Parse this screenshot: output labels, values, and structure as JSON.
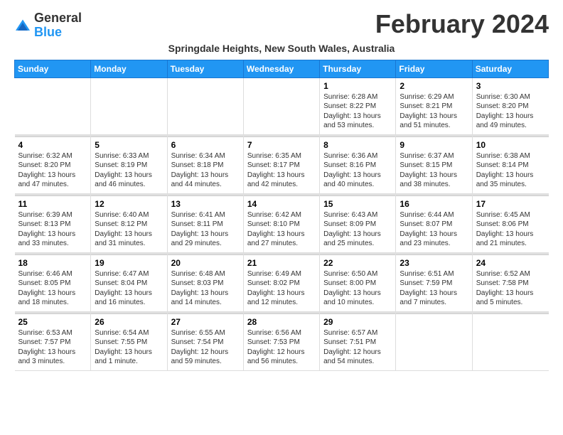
{
  "logo": {
    "general": "General",
    "blue": "Blue"
  },
  "title": "February 2024",
  "subtitle": "Springdale Heights, New South Wales, Australia",
  "days_of_week": [
    "Sunday",
    "Monday",
    "Tuesday",
    "Wednesday",
    "Thursday",
    "Friday",
    "Saturday"
  ],
  "weeks": [
    [
      {
        "num": "",
        "info": ""
      },
      {
        "num": "",
        "info": ""
      },
      {
        "num": "",
        "info": ""
      },
      {
        "num": "",
        "info": ""
      },
      {
        "num": "1",
        "info": "Sunrise: 6:28 AM\nSunset: 8:22 PM\nDaylight: 13 hours\nand 53 minutes."
      },
      {
        "num": "2",
        "info": "Sunrise: 6:29 AM\nSunset: 8:21 PM\nDaylight: 13 hours\nand 51 minutes."
      },
      {
        "num": "3",
        "info": "Sunrise: 6:30 AM\nSunset: 8:20 PM\nDaylight: 13 hours\nand 49 minutes."
      }
    ],
    [
      {
        "num": "4",
        "info": "Sunrise: 6:32 AM\nSunset: 8:20 PM\nDaylight: 13 hours\nand 47 minutes."
      },
      {
        "num": "5",
        "info": "Sunrise: 6:33 AM\nSunset: 8:19 PM\nDaylight: 13 hours\nand 46 minutes."
      },
      {
        "num": "6",
        "info": "Sunrise: 6:34 AM\nSunset: 8:18 PM\nDaylight: 13 hours\nand 44 minutes."
      },
      {
        "num": "7",
        "info": "Sunrise: 6:35 AM\nSunset: 8:17 PM\nDaylight: 13 hours\nand 42 minutes."
      },
      {
        "num": "8",
        "info": "Sunrise: 6:36 AM\nSunset: 8:16 PM\nDaylight: 13 hours\nand 40 minutes."
      },
      {
        "num": "9",
        "info": "Sunrise: 6:37 AM\nSunset: 8:15 PM\nDaylight: 13 hours\nand 38 minutes."
      },
      {
        "num": "10",
        "info": "Sunrise: 6:38 AM\nSunset: 8:14 PM\nDaylight: 13 hours\nand 35 minutes."
      }
    ],
    [
      {
        "num": "11",
        "info": "Sunrise: 6:39 AM\nSunset: 8:13 PM\nDaylight: 13 hours\nand 33 minutes."
      },
      {
        "num": "12",
        "info": "Sunrise: 6:40 AM\nSunset: 8:12 PM\nDaylight: 13 hours\nand 31 minutes."
      },
      {
        "num": "13",
        "info": "Sunrise: 6:41 AM\nSunset: 8:11 PM\nDaylight: 13 hours\nand 29 minutes."
      },
      {
        "num": "14",
        "info": "Sunrise: 6:42 AM\nSunset: 8:10 PM\nDaylight: 13 hours\nand 27 minutes."
      },
      {
        "num": "15",
        "info": "Sunrise: 6:43 AM\nSunset: 8:09 PM\nDaylight: 13 hours\nand 25 minutes."
      },
      {
        "num": "16",
        "info": "Sunrise: 6:44 AM\nSunset: 8:07 PM\nDaylight: 13 hours\nand 23 minutes."
      },
      {
        "num": "17",
        "info": "Sunrise: 6:45 AM\nSunset: 8:06 PM\nDaylight: 13 hours\nand 21 minutes."
      }
    ],
    [
      {
        "num": "18",
        "info": "Sunrise: 6:46 AM\nSunset: 8:05 PM\nDaylight: 13 hours\nand 18 minutes."
      },
      {
        "num": "19",
        "info": "Sunrise: 6:47 AM\nSunset: 8:04 PM\nDaylight: 13 hours\nand 16 minutes."
      },
      {
        "num": "20",
        "info": "Sunrise: 6:48 AM\nSunset: 8:03 PM\nDaylight: 13 hours\nand 14 minutes."
      },
      {
        "num": "21",
        "info": "Sunrise: 6:49 AM\nSunset: 8:02 PM\nDaylight: 13 hours\nand 12 minutes."
      },
      {
        "num": "22",
        "info": "Sunrise: 6:50 AM\nSunset: 8:00 PM\nDaylight: 13 hours\nand 10 minutes."
      },
      {
        "num": "23",
        "info": "Sunrise: 6:51 AM\nSunset: 7:59 PM\nDaylight: 13 hours\nand 7 minutes."
      },
      {
        "num": "24",
        "info": "Sunrise: 6:52 AM\nSunset: 7:58 PM\nDaylight: 13 hours\nand 5 minutes."
      }
    ],
    [
      {
        "num": "25",
        "info": "Sunrise: 6:53 AM\nSunset: 7:57 PM\nDaylight: 13 hours\nand 3 minutes."
      },
      {
        "num": "26",
        "info": "Sunrise: 6:54 AM\nSunset: 7:55 PM\nDaylight: 13 hours\nand 1 minute."
      },
      {
        "num": "27",
        "info": "Sunrise: 6:55 AM\nSunset: 7:54 PM\nDaylight: 12 hours\nand 59 minutes."
      },
      {
        "num": "28",
        "info": "Sunrise: 6:56 AM\nSunset: 7:53 PM\nDaylight: 12 hours\nand 56 minutes."
      },
      {
        "num": "29",
        "info": "Sunrise: 6:57 AM\nSunset: 7:51 PM\nDaylight: 12 hours\nand 54 minutes."
      },
      {
        "num": "",
        "info": ""
      },
      {
        "num": "",
        "info": ""
      }
    ]
  ]
}
